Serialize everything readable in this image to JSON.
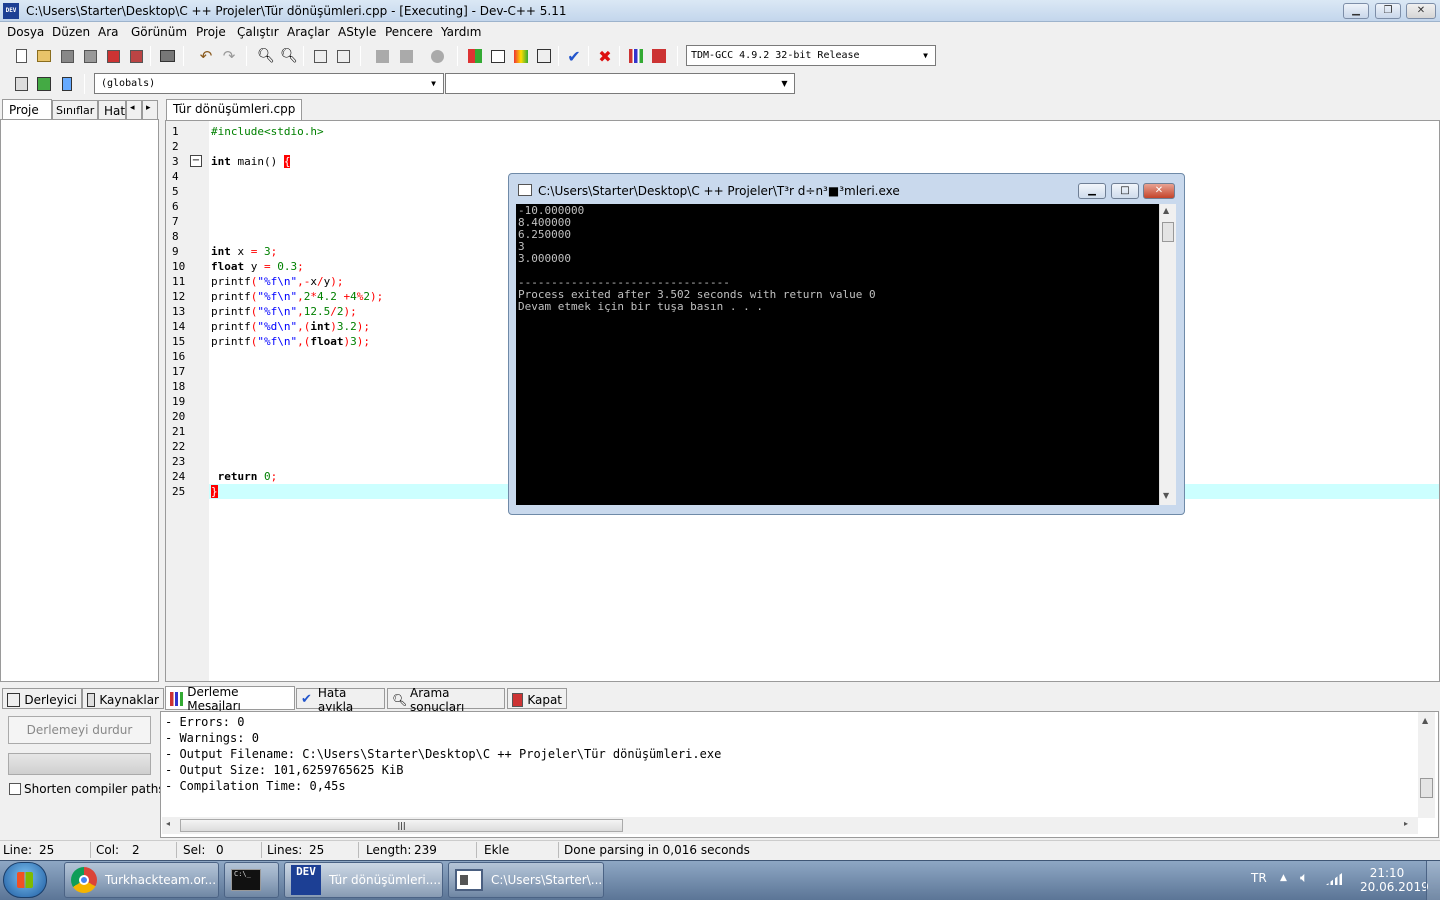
{
  "window": {
    "title": "C:\\Users\\Starter\\Desktop\\C ++ Projeler\\Tür dönüşümleri.cpp - [Executing] - Dev-C++ 5.11",
    "icon_text": "DEV",
    "minimize_icon": "minimize-icon",
    "maximize_icon": "restore-icon",
    "close_icon": "close-icon"
  },
  "menu": [
    "Dosya",
    "Düzen",
    "Ara",
    "Görünüm",
    "Proje",
    "Çalıştır",
    "Araçlar",
    "AStyle",
    "Pencere",
    "Yardım"
  ],
  "toolbar": {
    "compiler": "TDM-GCC 4.9.2 32-bit Release",
    "scope": "(globals)",
    "function": ""
  },
  "left_tabs": [
    "Proje",
    "Sınıflar",
    "Hat"
  ],
  "editor": {
    "tab": "Tür dönüşümleri.cpp",
    "line_numbers": [
      "1",
      "2",
      "3",
      "4",
      "5",
      "6",
      "7",
      "8",
      "9",
      "10",
      "11",
      "12",
      "13",
      "14",
      "15",
      "16",
      "17",
      "18",
      "19",
      "20",
      "21",
      "22",
      "23",
      "24",
      "25"
    ],
    "fold_symbol": "−"
  },
  "console": {
    "title": "C:\\Users\\Starter\\Desktop\\C ++ Projeler\\T³r d÷n³■³mleri.exe",
    "lines": [
      "-10.000000",
      "8.400000",
      "6.250000",
      "3",
      "3.000000",
      "",
      "--------------------------------",
      "Process exited after 3.502 seconds with return value 0",
      "Devam etmek için bir tuşa basın . . ."
    ]
  },
  "bottom_tabs": [
    "Derleyici",
    "Kaynaklar",
    "Derleme Mesajları",
    "Hata ayıkla",
    "Arama sonuçları",
    "Kapat"
  ],
  "compile": {
    "stop_button": "Derlemeyi durdur",
    "shorten_label": "Shorten compiler paths",
    "shorten_checked": false,
    "output": [
      "- Errors: 0",
      "- Warnings: 0",
      "- Output Filename: C:\\Users\\Starter\\Desktop\\C ++ Projeler\\Tür dönüşümleri.exe",
      "- Output Size: 101,6259765625 KiB",
      "- Compilation Time: 0,45s"
    ]
  },
  "status": {
    "line_label": "Line:",
    "line": "25",
    "col_label": "Col:",
    "col": "2",
    "sel_label": "Sel:",
    "sel": "0",
    "lines_label": "Lines:",
    "lines": "25",
    "length_label": "Length:",
    "length": "239",
    "mode": "Ekle",
    "message": "Done parsing in 0,016 seconds"
  },
  "taskbar": {
    "items": [
      "Turkhackteam.or...",
      "",
      "Tür dönüşümleri....",
      "C:\\Users\\Starter\\..."
    ],
    "dev_icon_text": "DEV",
    "cmd_icon_text": "C:\\_",
    "language": "TR",
    "time": "21:10",
    "date": "20.06.2019"
  },
  "colors": {
    "keyword": "#000000",
    "string": "#0000ff",
    "number": "#008000",
    "operator": "#ff0000",
    "current_line": "#ccffff",
    "console_bg": "#000000",
    "console_text": "#c0c0c0"
  }
}
